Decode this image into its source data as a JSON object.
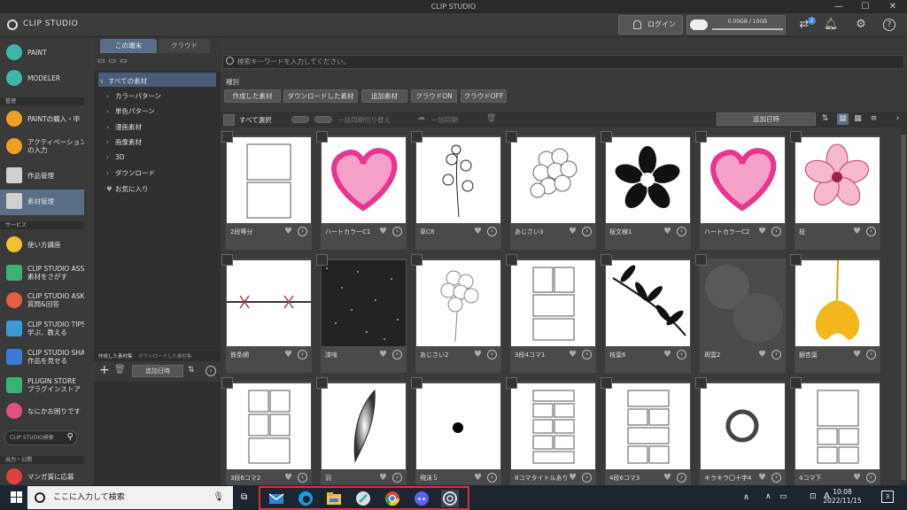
{
  "window": {
    "title": "CLIP STUDIO",
    "minimize": "—",
    "maximize": "☐",
    "close": "✕"
  },
  "header": {
    "app_title": "CLIP STUDIO",
    "login_label": "ログイン",
    "storage_text": "0.00GB / 10GB",
    "sync_badge": "2"
  },
  "sidebar": {
    "apps": [
      {
        "label": "PAINT",
        "color": "#3db8a8"
      },
      {
        "label": "MODELER",
        "color": "#3db8a8"
      }
    ],
    "section_manage": "管理",
    "manage_items": [
      {
        "label": "PAINTの購入・申",
        "color": "#f0a020"
      },
      {
        "label": "アクティベーション",
        "label2": "の入力",
        "color": "#f0a020"
      },
      {
        "label": "作品管理",
        "color": "#d0d0d0"
      },
      {
        "label": "素材管理",
        "color": "#d0d0d0"
      }
    ],
    "section_service": "サービス",
    "service_items": [
      {
        "label": "使い方講座",
        "color": "#f0c030"
      },
      {
        "label": "CLIP STUDIO ASS",
        "label2": "素材をさがす",
        "color": "#3bb07a"
      },
      {
        "label": "CLIP STUDIO ASK",
        "label2": "質問&回答",
        "color": "#e06040"
      },
      {
        "label": "CLIP STUDIO TIPS",
        "label2": "学ぶ、教える",
        "color": "#3a9ad8"
      },
      {
        "label": "CLIP STUDIO SHA",
        "label2": "作品を見せる",
        "color": "#3a7ad8"
      },
      {
        "label": "PLUGIN STORE",
        "label2": "プラグインストア",
        "color": "#3bb07a"
      },
      {
        "label": "なにかお困りです",
        "color": "#e05080"
      }
    ],
    "search_placeholder": "CLIP STUDIO検索",
    "section_publish": "出力・公開",
    "publish_items": [
      {
        "label": "マンガ賞に応募",
        "color": "#e04040"
      }
    ]
  },
  "tree": {
    "tabs": [
      "この端末",
      "クラウド"
    ],
    "items": [
      {
        "label": "すべての素材",
        "glyph": "∨"
      },
      {
        "label": "カラーパターン",
        "glyph": "›"
      },
      {
        "label": "単色パターン",
        "glyph": "›"
      },
      {
        "label": "漫画素材",
        "glyph": "›"
      },
      {
        "label": "画像素材",
        "glyph": "›"
      },
      {
        "label": "3D",
        "glyph": "›"
      },
      {
        "label": "ダウンロード",
        "glyph": "›"
      },
      {
        "label": "お気に入り",
        "glyph": "♥"
      }
    ],
    "lower_tabs": [
      "作成した素材集",
      "ダウンロードした素材集"
    ],
    "lower_sort": "追加日時"
  },
  "main": {
    "search_placeholder": "検索キーワードを入力してください。",
    "kind_label": "種別",
    "filters": [
      "作成した素材",
      "ダウンロードした素材",
      "追加素材",
      "クラウドON",
      "クラウドOFF"
    ],
    "select_all": "すべて選択",
    "bulk_sync_toggle": "一括同期切り替え",
    "bulk_sync": "一括同期",
    "sort_label": "追加日時",
    "items": [
      {
        "name": "2段等分",
        "art": "panels2"
      },
      {
        "name": "ハートカラーC1",
        "art": "heart"
      },
      {
        "name": "草C8",
        "art": "plant"
      },
      {
        "name": "あじさい3",
        "art": "hydrangea"
      },
      {
        "name": "桜文様1",
        "art": "sakura-mono"
      },
      {
        "name": "ハートカラーC2",
        "art": "heart"
      },
      {
        "name": "桜",
        "art": "sakura"
      },
      {
        "name": "鉄条網",
        "art": "wire"
      },
      {
        "name": "漆喰",
        "art": "noise"
      },
      {
        "name": "あじさい2",
        "art": "hydrangea2"
      },
      {
        "name": "3段4コマ1",
        "art": "panels34"
      },
      {
        "name": "枝葉6",
        "art": "leaves"
      },
      {
        "name": "斑雲2",
        "art": "cloudnoise"
      },
      {
        "name": "銀杏葉",
        "art": "ginkgo"
      },
      {
        "name": "3段6コマ2",
        "art": "panels36"
      },
      {
        "name": "羽",
        "art": "feather"
      },
      {
        "name": "飛沫５",
        "art": "splash"
      },
      {
        "name": "8コマタイトルあり",
        "art": "panels8"
      },
      {
        "name": "4段6コマ3",
        "art": "panels46"
      },
      {
        "name": "キラキラ〇十字4",
        "art": "ring"
      },
      {
        "name": "4コマ下",
        "art": "panels4"
      }
    ]
  },
  "taskbar": {
    "search_placeholder": "ここに入力して検索",
    "time": "10:08",
    "date": "2022/11/15",
    "ime": "A",
    "notification_count": "3",
    "pinned": [
      "mail",
      "edge",
      "explorer",
      "clip-paint",
      "chrome",
      "discord",
      "clip-studio"
    ]
  }
}
